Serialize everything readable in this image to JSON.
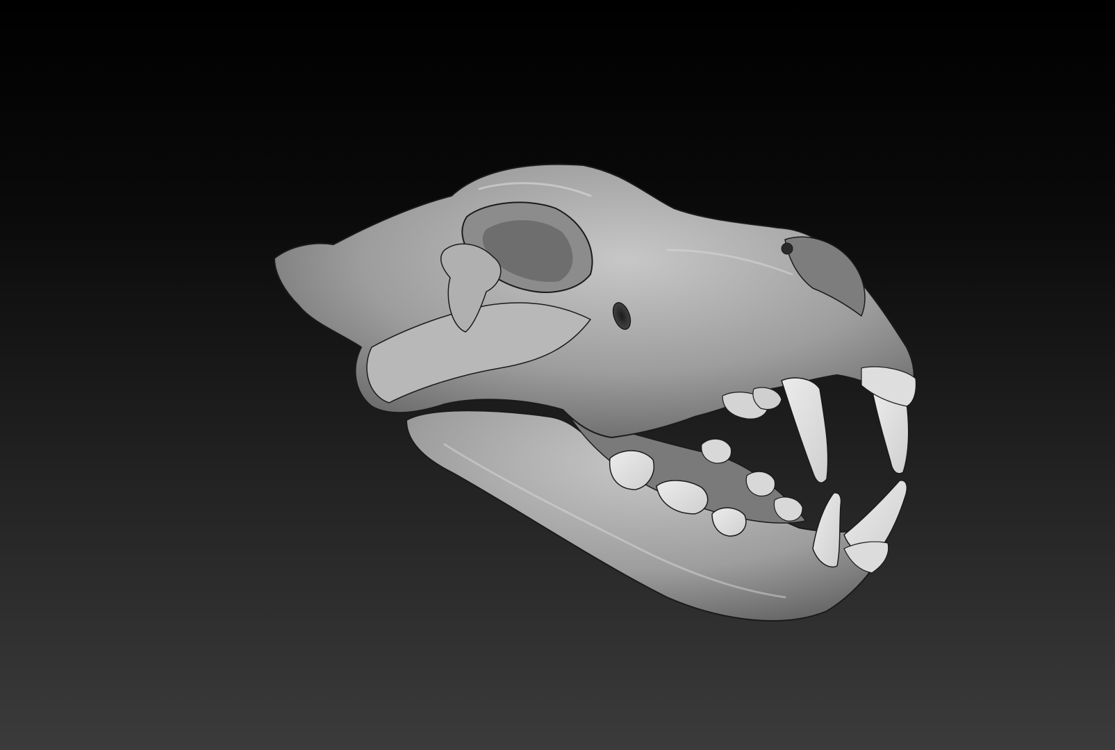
{
  "viewport": {
    "background_top": "#000000",
    "background_bottom": "#3b3b3b"
  },
  "model": {
    "bone_light": "#c7c7c7",
    "bone_mid": "#9d9d9d",
    "bone_dark": "#5e5e5e",
    "tooth_light": "#ececec",
    "tooth_mid": "#cfcfcf",
    "outline": "#1a1a1a"
  }
}
